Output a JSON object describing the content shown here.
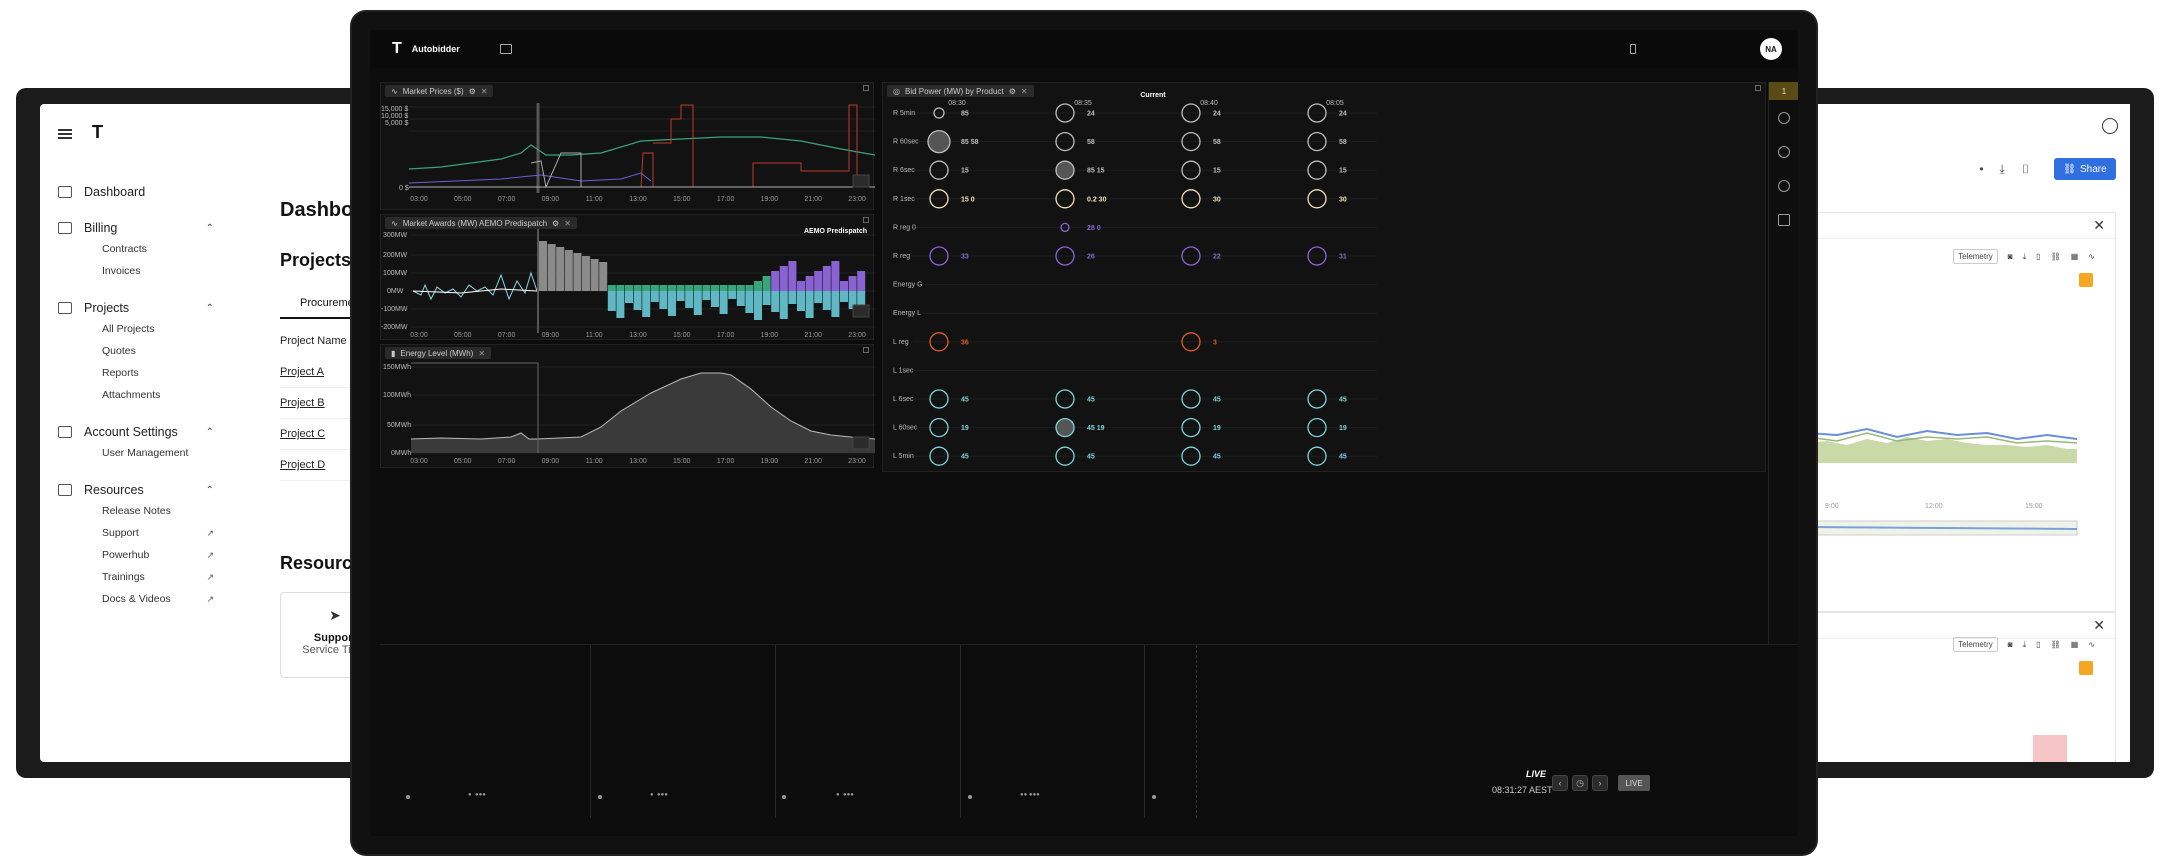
{
  "left_app": {
    "nav": [
      {
        "label": "Dashboard",
        "children": []
      },
      {
        "label": "Billing",
        "children": [
          {
            "label": "Contracts"
          },
          {
            "label": "Invoices"
          }
        ]
      },
      {
        "label": "Projects",
        "children": [
          {
            "label": "All Projects"
          },
          {
            "label": "Quotes"
          },
          {
            "label": "Reports"
          },
          {
            "label": "Attachments"
          }
        ]
      },
      {
        "label": "Account Settings",
        "children": [
          {
            "label": "User Management"
          }
        ]
      },
      {
        "label": "Resources",
        "children": [
          {
            "label": "Release Notes"
          },
          {
            "label": "Support"
          },
          {
            "label": "Powerhub"
          },
          {
            "label": "Trainings"
          },
          {
            "label": "Docs & Videos"
          }
        ]
      }
    ],
    "main": {
      "title": "Dashboard",
      "section": "Projects",
      "tab": "Procurement",
      "col_header": "Project Name",
      "rows": [
        "Project A",
        "Project B",
        "Project C",
        "Project D"
      ],
      "resources_title": "Resources",
      "support_card": {
        "title": "Support",
        "subtitle": "Service Ticke"
      }
    }
  },
  "right_app": {
    "share_label": "Share",
    "telemetry_label": "Telemetry",
    "axis_ticks": [
      "9:00",
      "12:00",
      "15:00"
    ]
  },
  "center_app": {
    "app_name": "Autobidder",
    "avatar": "NA",
    "strip_badge": "1",
    "market_prices": {
      "tab": "Market Prices ($)",
      "y_labels": [
        "15,000 $",
        "10,000 $",
        "5,000 $",
        "0 $"
      ],
      "x_ticks": [
        "03:00",
        "05:00",
        "07:00",
        "09:00",
        "11:00",
        "13:00",
        "15:00",
        "17:00",
        "19:00",
        "21:00",
        "23:00"
      ]
    },
    "market_awards": {
      "tab": "Market Awards (MW) AEMO Predispatch",
      "label": "AEMO Predispatch",
      "y_labels": [
        "300MW",
        "200MW",
        "100MW",
        "0MW",
        "-100MW",
        "-200MW"
      ],
      "x_ticks": [
        "03:00",
        "05:00",
        "07:00",
        "09:00",
        "11:00",
        "13:00",
        "15:00",
        "17:00",
        "19:00",
        "21:00",
        "23:00"
      ]
    },
    "energy_level": {
      "tab": "Energy Level (MWh)",
      "y_labels": [
        "150MWh",
        "100MWh",
        "50MWh",
        "0MWh"
      ],
      "x_ticks": [
        "03:00",
        "05:00",
        "07:00",
        "09:00",
        "11:00",
        "13:00",
        "15:00",
        "17:00",
        "19:00",
        "21:00",
        "23:00"
      ]
    },
    "bid_power": {
      "tab": "Bid Power (MW) by Product",
      "current_label": "Current",
      "times": [
        "08:30",
        "08:35",
        "08:40",
        "08:05"
      ],
      "rows": [
        {
          "label": "R 5min",
          "cells": [
            "85",
            "24",
            "24",
            "24"
          ]
        },
        {
          "label": "R 60sec",
          "cells": [
            "85 58",
            "58",
            "58",
            "58"
          ]
        },
        {
          "label": "R 6sec",
          "cells": [
            "15",
            "85 15",
            "15",
            "15"
          ]
        },
        {
          "label": "R 1sec",
          "cells": [
            "15 0",
            "0.2 30",
            "30",
            "30"
          ]
        },
        {
          "label": "R reg 0",
          "cells": [
            "",
            "28 0",
            "",
            ""
          ]
        },
        {
          "label": "R reg",
          "cells": [
            "33",
            "26",
            "22",
            "31"
          ]
        },
        {
          "label": "Energy G",
          "cells": [
            "",
            "",
            "",
            ""
          ]
        },
        {
          "label": "Energy L",
          "cells": [
            "",
            "",
            "",
            ""
          ]
        },
        {
          "label": "L reg",
          "cells": [
            "36",
            "",
            "3",
            ""
          ]
        },
        {
          "label": "L 1sec",
          "cells": [
            "",
            "",
            "",
            ""
          ]
        },
        {
          "label": "L 6sec",
          "cells": [
            "45",
            "45",
            "45",
            "45"
          ]
        },
        {
          "label": "L 60sec",
          "cells": [
            "19",
            "45 19",
            "19",
            "19"
          ]
        },
        {
          "label": "L 5min",
          "cells": [
            "45",
            "45",
            "45",
            "45"
          ]
        }
      ]
    },
    "live": {
      "label": "LIVE",
      "time": "08:31:27 AEST",
      "button": "LIVE"
    }
  }
}
